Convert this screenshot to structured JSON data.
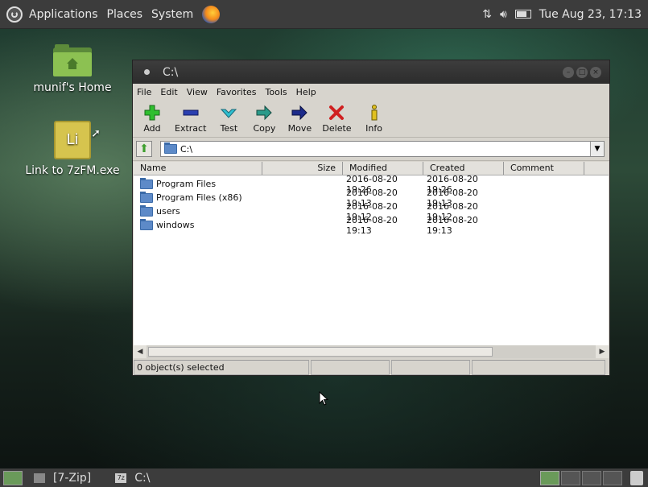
{
  "top_panel": {
    "menus": [
      "Applications",
      "Places",
      "System"
    ],
    "clock": "Tue Aug 23, 17:13"
  },
  "desktop": {
    "icons": [
      {
        "label": "munif's Home",
        "icon": "home-folder-icon"
      },
      {
        "label": "Link to 7zFM.exe",
        "icon": "exe-link-icon",
        "glyph": "Li"
      }
    ]
  },
  "window": {
    "title": "C:\\",
    "menu": [
      "File",
      "Edit",
      "View",
      "Favorites",
      "Tools",
      "Help"
    ],
    "toolbar": [
      {
        "label": "Add",
        "icon": "add-icon",
        "color": "#2fbf2f"
      },
      {
        "label": "Extract",
        "icon": "extract-icon",
        "color": "#2a3fb0"
      },
      {
        "label": "Test",
        "icon": "test-icon",
        "color": "#2fbfcf"
      },
      {
        "label": "Copy",
        "icon": "copy-icon",
        "color": "#2a9a8a"
      },
      {
        "label": "Move",
        "icon": "move-icon",
        "color": "#1c2a8a"
      },
      {
        "label": "Delete",
        "icon": "delete-icon",
        "color": "#d02020"
      },
      {
        "label": "Info",
        "icon": "info-icon",
        "color": "#e0c020"
      }
    ],
    "address": "C:\\",
    "columns": [
      "Name",
      "Size",
      "Modified",
      "Created",
      "Comment"
    ],
    "rows": [
      {
        "name": "Program Files",
        "size": "",
        "modified": "2016-08-20 19:26",
        "created": "2016-08-20 19:26"
      },
      {
        "name": "Program Files (x86)",
        "size": "",
        "modified": "2016-08-20 19:13",
        "created": "2016-08-20 19:13"
      },
      {
        "name": "users",
        "size": "",
        "modified": "2016-08-20 19:12",
        "created": "2016-08-20 19:12"
      },
      {
        "name": "windows",
        "size": "",
        "modified": "2016-08-20 19:13",
        "created": "2016-08-20 19:13"
      }
    ],
    "status": "0 object(s) selected"
  },
  "bottom_panel": {
    "tasks": [
      "[7-Zip]",
      "C:\\"
    ]
  }
}
